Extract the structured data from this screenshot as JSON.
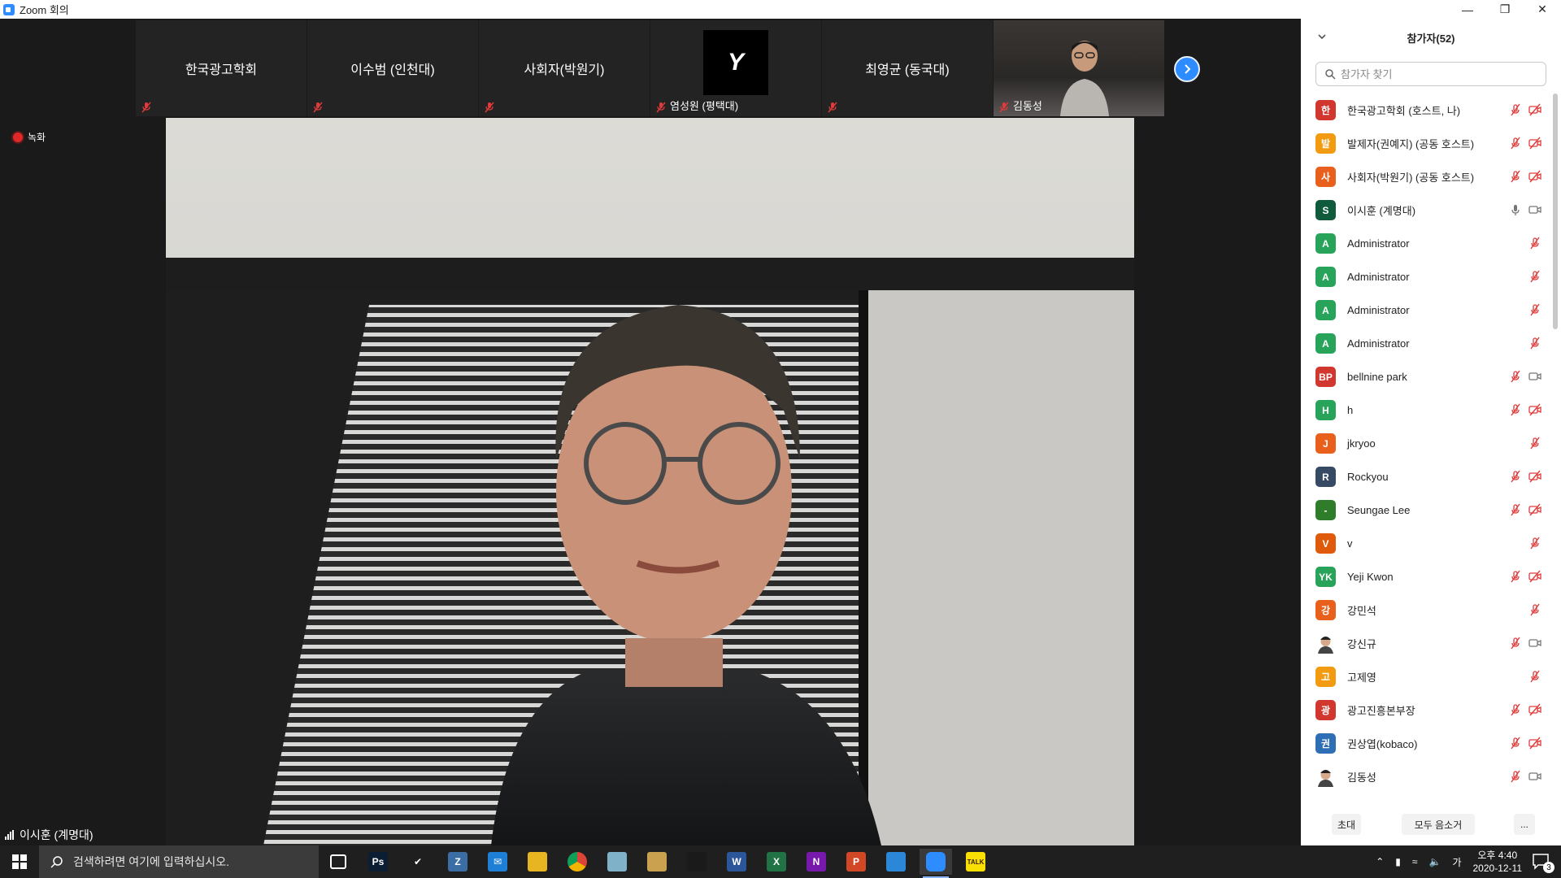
{
  "window": {
    "title": "Zoom 회의"
  },
  "strip": {
    "tiles": [
      {
        "label": "한국광고학회"
      },
      {
        "label": "이수범 (인천대)"
      },
      {
        "label": "사회자(박원기)"
      },
      {
        "label": "염성원 (평택대)",
        "avatar_letter": "Y"
      },
      {
        "label": "최영균 (동국대)"
      },
      {
        "label": "김동성"
      }
    ]
  },
  "recording": {
    "label": "녹화"
  },
  "speaker": {
    "name": "이시훈 (계명대)"
  },
  "panel": {
    "title": "참가자(52)",
    "search_placeholder": "참가자 찾기",
    "participants": [
      {
        "avatar": "한",
        "color": "#d1372e",
        "name": "한국광고학회 (호스트, 나)",
        "mic": "muted",
        "video": "off"
      },
      {
        "avatar": "발",
        "color": "#f29b11",
        "name": "발제자(권예지) (공동 호스트)",
        "mic": "muted",
        "video": "off"
      },
      {
        "avatar": "사",
        "color": "#e8601c",
        "name": "사회자(박원기) (공동 호스트)",
        "mic": "muted",
        "video": "off"
      },
      {
        "avatar": "S",
        "color": "#0f5b3c",
        "name": "이시훈 (계명대)",
        "mic": "on",
        "video": "on"
      },
      {
        "avatar": "A",
        "color": "#27a35a",
        "name": "Administrator",
        "mic": "muted",
        "video": "none"
      },
      {
        "avatar": "A",
        "color": "#27a35a",
        "name": "Administrator",
        "mic": "muted",
        "video": "none"
      },
      {
        "avatar": "A",
        "color": "#27a35a",
        "name": "Administrator",
        "mic": "muted",
        "video": "none"
      },
      {
        "avatar": "A",
        "color": "#27a35a",
        "name": "Administrator",
        "mic": "muted",
        "video": "none"
      },
      {
        "avatar": "BP",
        "color": "#d1372e",
        "name": "bellnine park",
        "mic": "muted",
        "video": "on"
      },
      {
        "avatar": "H",
        "color": "#27a35a",
        "name": "h",
        "mic": "muted",
        "video": "off"
      },
      {
        "avatar": "J",
        "color": "#e8601c",
        "name": "jkryoo",
        "mic": "muted",
        "video": "none"
      },
      {
        "avatar": "R",
        "color": "#364a64",
        "name": "Rockyou",
        "mic": "muted",
        "video": "off"
      },
      {
        "avatar": "-",
        "color": "#2f7d2a",
        "name": "Seungae Lee",
        "mic": "muted",
        "video": "off"
      },
      {
        "avatar": "V",
        "color": "#e05a0c",
        "name": "v",
        "mic": "muted",
        "video": "none"
      },
      {
        "avatar": "YK",
        "color": "#27a35a",
        "name": "Yeji Kwon",
        "mic": "muted",
        "video": "off"
      },
      {
        "avatar": "강",
        "color": "#e8601c",
        "name": "강민석",
        "mic": "muted",
        "video": "none"
      },
      {
        "avatar": "",
        "color": "#ffffff",
        "name": "강신규",
        "mic": "muted",
        "video": "on",
        "photo": true
      },
      {
        "avatar": "고",
        "color": "#f29b11",
        "name": "고제영",
        "mic": "muted",
        "video": "none"
      },
      {
        "avatar": "광",
        "color": "#d1372e",
        "name": "광고진흥본부장",
        "mic": "muted",
        "video": "off"
      },
      {
        "avatar": "권",
        "color": "#2d6eb5",
        "name": "권상엽(kobaco)",
        "mic": "muted",
        "video": "off"
      },
      {
        "avatar": "",
        "color": "#ffffff",
        "name": "김동성",
        "mic": "muted",
        "video": "on",
        "photo": true
      }
    ],
    "footer": {
      "invite": "초대",
      "mute_all": "모두 음소거",
      "more": "..."
    }
  },
  "taskbar": {
    "search_placeholder": "검색하려면 여기에 입력하십시오.",
    "apps": [
      {
        "name": "task-view-icon",
        "label": ""
      },
      {
        "name": "photoshop-icon",
        "label": "Ps",
        "color": "#0b1e33"
      },
      {
        "name": "todo-icon",
        "label": "✔",
        "color": "#1f1f1f"
      },
      {
        "name": "zoom-client-icon",
        "label": "Z",
        "color": "#3a6ea5"
      },
      {
        "name": "mail-icon",
        "label": "✉",
        "color": "#1e7fd6"
      },
      {
        "name": "explorer-icon",
        "label": "",
        "color": "#e7b422"
      },
      {
        "name": "chrome-icon",
        "label": "",
        "color": "#dd4b39"
      },
      {
        "name": "notes-icon",
        "label": "",
        "color": "#7fb2c9"
      },
      {
        "name": "paint-icon",
        "label": "",
        "color": "#c9a14f"
      },
      {
        "name": "acrobat-icon",
        "label": "",
        "color": "#1a1a1a"
      },
      {
        "name": "word-icon",
        "label": "W",
        "color": "#2b579a"
      },
      {
        "name": "excel-icon",
        "label": "X",
        "color": "#217346"
      },
      {
        "name": "onenote-icon",
        "label": "N",
        "color": "#7719aa"
      },
      {
        "name": "powerpoint-icon",
        "label": "P",
        "color": "#d24726"
      },
      {
        "name": "store-icon",
        "label": "",
        "color": "#2b88d8"
      },
      {
        "name": "zoom-meeting-icon",
        "label": "",
        "color": "#2d8cff"
      },
      {
        "name": "kakaotalk-icon",
        "label": "TALK",
        "color": "#f9e000"
      }
    ],
    "ime": "가",
    "time": "오후 4:40",
    "date": "2020-12-11",
    "notifications": "3"
  }
}
